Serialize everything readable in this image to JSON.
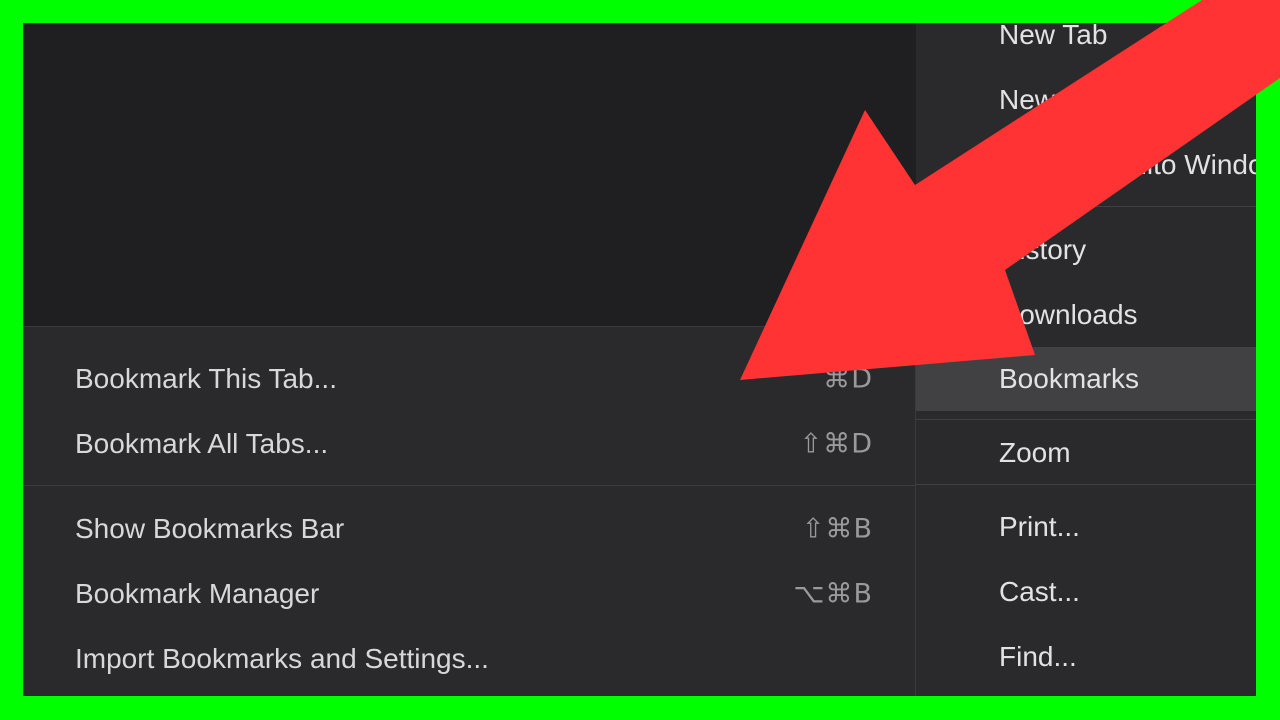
{
  "main_menu": {
    "items": [
      {
        "label": "New Tab"
      },
      {
        "label": "New Window"
      },
      {
        "label": "New Incognito Window"
      },
      {
        "label": "History"
      },
      {
        "label": "Downloads"
      },
      {
        "label": "Bookmarks"
      },
      {
        "label": "Zoom"
      },
      {
        "label": "Print..."
      },
      {
        "label": "Cast..."
      },
      {
        "label": "Find..."
      }
    ],
    "active_item": "Bookmarks"
  },
  "bookmarks_submenu": {
    "items": [
      {
        "label": "Bookmark This Tab...",
        "shortcut": "⌘D"
      },
      {
        "label": "Bookmark All Tabs...",
        "shortcut": "⇧⌘D"
      },
      {
        "label": "Show Bookmarks Bar",
        "shortcut": "⇧⌘B"
      },
      {
        "label": "Bookmark Manager",
        "shortcut": "⌥⌘B"
      },
      {
        "label": "Import Bookmarks and Settings...",
        "shortcut": ""
      }
    ]
  },
  "colors": {
    "frame_border": "#00ff00",
    "arrow": "#ff3333",
    "menu_bg": "#2a2a2c",
    "active_bg": "#414144"
  },
  "overlay": {
    "arrow_icon": "red-arrow-icon"
  }
}
